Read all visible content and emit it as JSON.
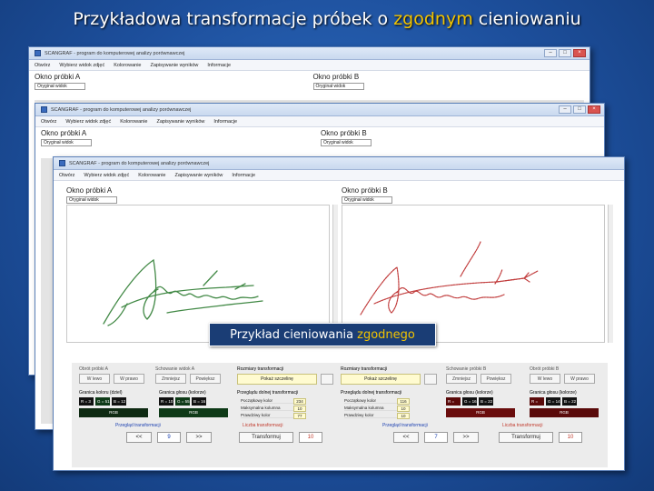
{
  "slide": {
    "title_prefix": "Przykładowa transformacje próbek o ",
    "title_highlight": "zgodnym",
    "title_suffix": " cieniowaniu"
  },
  "app": {
    "title": "SCANGRAF - program do komputerowej analizy porównawczej",
    "menu": [
      "Otwórz",
      "Wybierz widok zdjęć",
      "Kolorowanie",
      "Zapisywanie wyników",
      "Informacje"
    ],
    "panel_a_label": "Okno próbki A",
    "panel_b_label": "Okno próbki B",
    "dropdown_value": "Oryginał widok"
  },
  "overlay": {
    "text": "Przykład cieniowania ",
    "highlight": "zgodnego"
  },
  "controls": {
    "left_group": "Obrót próbki A",
    "view_group_a": "Schowanie widok A",
    "params_group": "Rozmiary transformacji",
    "params_group_b": "Rozmiary transformacji",
    "view_group_b": "Schowanie próbki B",
    "right_group": "Obrót próbki B",
    "btn_in": "W lewo",
    "btn_out": "W prawo",
    "btn_reduce": "Zmniejsz",
    "btn_enlarge": "Powiększ",
    "color_a_label": "Granica koloru (dziel)",
    "color_b_label": "Granica głosu (kolorze)",
    "a_rgb1": [
      "R = 3",
      "G = 51",
      "B = 12"
    ],
    "a_rgb2": [
      "R = 10",
      "G = 55",
      "B = 16"
    ],
    "b_rgb1": [
      "R = 143",
      "G = 16",
      "B = 22"
    ],
    "b_rgb2": [
      "R = 143",
      "G = 14",
      "B = 22"
    ],
    "rgb_btn": "RGB",
    "yellow_field": "Pokaż szczelinę",
    "table_title": "Przeglądu dolnej transformacji",
    "table_rows": [
      {
        "k": "Początkowy kolor",
        "v": "234"
      },
      {
        "k": "Maksymalna kolumna",
        "v": "10"
      },
      {
        "k": "Prawdziwy kolor",
        "v": "77"
      }
    ],
    "table_b_rows": [
      {
        "k": "Początkowy kolor",
        "v": "116"
      },
      {
        "k": "Maksymalna kolumna",
        "v": "10"
      },
      {
        "k": "Prawdziwy kolor",
        "v": "10"
      }
    ],
    "nav_a_label": "Przegląd transformacji",
    "nav_a_count_label": "Liczba transformacji",
    "nav_a_value": "9",
    "nav_a_count": "10",
    "nav_b_value": "7",
    "nav_b_count": "10",
    "btn_prev": "<<",
    "btn_next": ">>",
    "btn_transform": "Transformuj"
  },
  "colors": {
    "signature_a": "#2e7d32",
    "signature_b": "#b71c1c",
    "accent": "#f3c400"
  }
}
